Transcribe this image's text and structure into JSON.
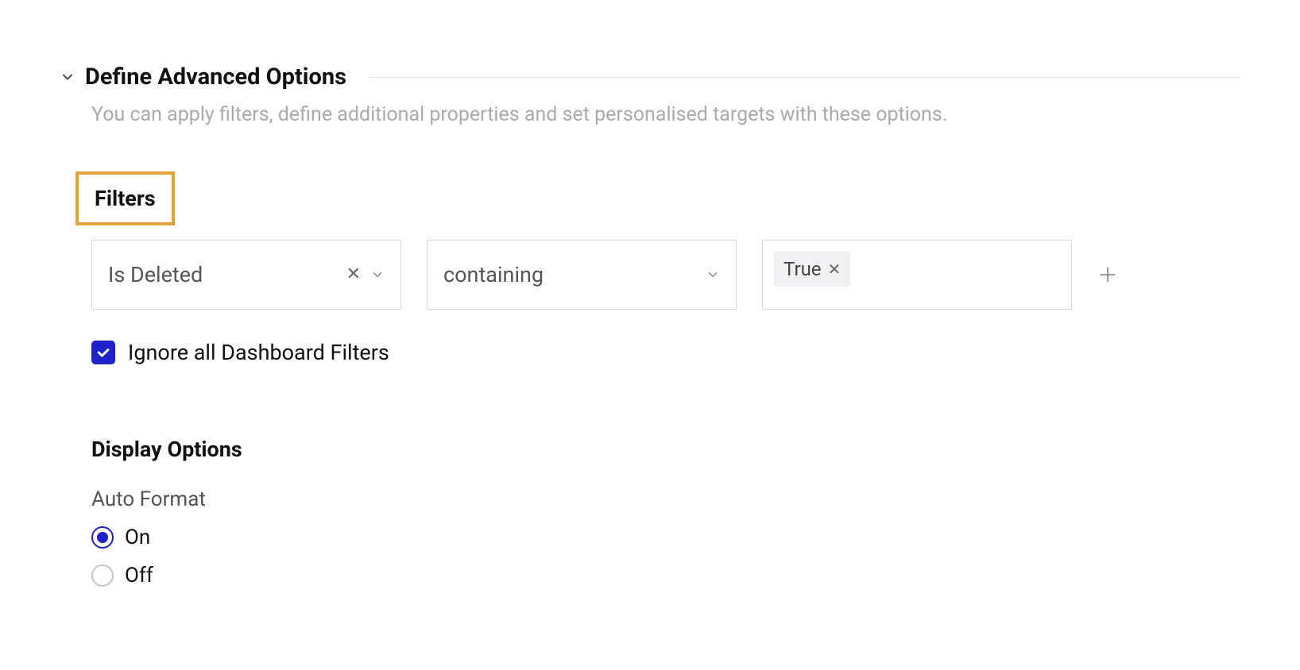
{
  "section": {
    "title": "Define Advanced Options",
    "subtitle": "You can apply filters, define additional properties and set personalised targets with these options."
  },
  "filters": {
    "heading": "Filters",
    "field_select": {
      "value": "Is Deleted"
    },
    "operator_select": {
      "value": "containing"
    },
    "value_tag": {
      "label": "True"
    },
    "ignore_dashboard_checkbox": {
      "checked": true,
      "label": "Ignore all Dashboard Filters"
    }
  },
  "display_options": {
    "heading": "Display Options",
    "auto_format": {
      "label": "Auto Format",
      "options": {
        "on": "On",
        "off": "Off"
      },
      "selected": "on"
    }
  }
}
